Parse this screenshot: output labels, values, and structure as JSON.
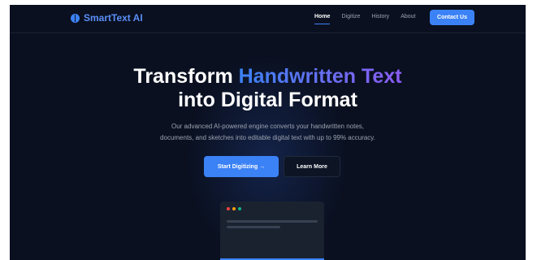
{
  "brand": {
    "name": "SmartText AI",
    "icon": "brain-icon"
  },
  "nav": {
    "links": [
      "Home",
      "Digitize",
      "History",
      "About"
    ],
    "active": "Home",
    "contact_label": "Contact Us"
  },
  "hero": {
    "title_part1": "Transform ",
    "title_highlight": "Handwritten Text",
    "title_line2": "into Digital Format",
    "subtitle_line1": "Our advanced AI-powered engine converts your handwritten notes,",
    "subtitle_line2": "documents, and sketches into editable digital text with up to 99% accuracy.",
    "primary_cta": "Start Digitizing →",
    "secondary_cta": "Learn More"
  },
  "colors": {
    "accent": "#3b82f6",
    "gradient_end": "#8b5cf6",
    "background": "#0a1020",
    "window_dot_red": "#ef4444",
    "window_dot_yellow": "#f59e0b",
    "window_dot_green": "#10b981"
  }
}
